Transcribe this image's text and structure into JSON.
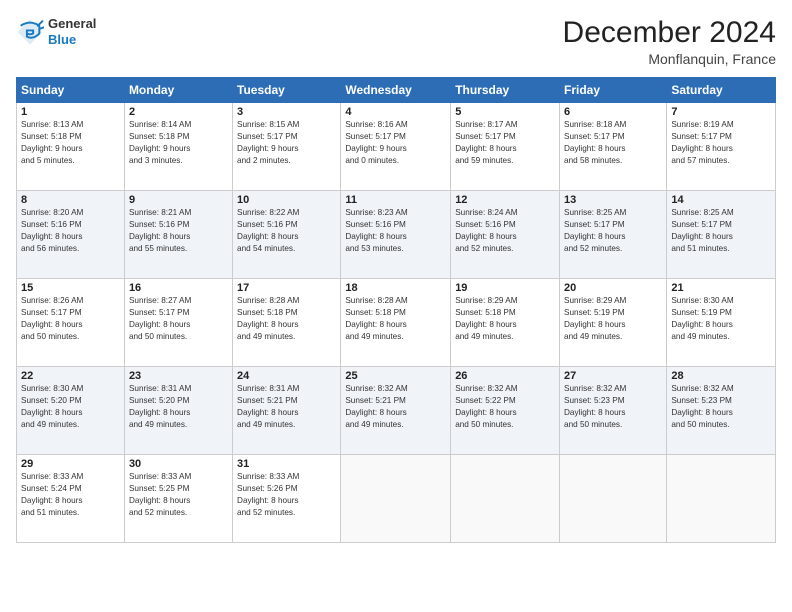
{
  "logo": {
    "general": "General",
    "blue": "Blue"
  },
  "header": {
    "title": "December 2024",
    "subtitle": "Monflanquin, France"
  },
  "calendar": {
    "headers": [
      "Sunday",
      "Monday",
      "Tuesday",
      "Wednesday",
      "Thursday",
      "Friday",
      "Saturday"
    ],
    "weeks": [
      [
        null,
        null,
        null,
        null,
        null,
        null,
        {
          "day": "7",
          "sunrise": "8:19 AM",
          "sunset": "5:17 PM",
          "daylight": "8 hours and 57 minutes."
        }
      ],
      [
        {
          "day": "1",
          "sunrise": "8:13 AM",
          "sunset": "5:18 PM",
          "daylight": "9 hours and 5 minutes."
        },
        {
          "day": "2",
          "sunrise": "8:14 AM",
          "sunset": "5:18 PM",
          "daylight": "9 hours and 3 minutes."
        },
        {
          "day": "3",
          "sunrise": "8:15 AM",
          "sunset": "5:17 PM",
          "daylight": "9 hours and 2 minutes."
        },
        {
          "day": "4",
          "sunrise": "8:16 AM",
          "sunset": "5:17 PM",
          "daylight": "9 hours and 0 minutes."
        },
        {
          "day": "5",
          "sunrise": "8:17 AM",
          "sunset": "5:17 PM",
          "daylight": "8 hours and 59 minutes."
        },
        {
          "day": "6",
          "sunrise": "8:18 AM",
          "sunset": "5:17 PM",
          "daylight": "8 hours and 58 minutes."
        },
        {
          "day": "7",
          "sunrise": "8:19 AM",
          "sunset": "5:17 PM",
          "daylight": "8 hours and 57 minutes."
        }
      ],
      [
        {
          "day": "8",
          "sunrise": "8:20 AM",
          "sunset": "5:16 PM",
          "daylight": "8 hours and 56 minutes."
        },
        {
          "day": "9",
          "sunrise": "8:21 AM",
          "sunset": "5:16 PM",
          "daylight": "8 hours and 55 minutes."
        },
        {
          "day": "10",
          "sunrise": "8:22 AM",
          "sunset": "5:16 PM",
          "daylight": "8 hours and 54 minutes."
        },
        {
          "day": "11",
          "sunrise": "8:23 AM",
          "sunset": "5:16 PM",
          "daylight": "8 hours and 53 minutes."
        },
        {
          "day": "12",
          "sunrise": "8:24 AM",
          "sunset": "5:16 PM",
          "daylight": "8 hours and 52 minutes."
        },
        {
          "day": "13",
          "sunrise": "8:25 AM",
          "sunset": "5:17 PM",
          "daylight": "8 hours and 52 minutes."
        },
        {
          "day": "14",
          "sunrise": "8:25 AM",
          "sunset": "5:17 PM",
          "daylight": "8 hours and 51 minutes."
        }
      ],
      [
        {
          "day": "15",
          "sunrise": "8:26 AM",
          "sunset": "5:17 PM",
          "daylight": "8 hours and 50 minutes."
        },
        {
          "day": "16",
          "sunrise": "8:27 AM",
          "sunset": "5:17 PM",
          "daylight": "8 hours and 50 minutes."
        },
        {
          "day": "17",
          "sunrise": "8:28 AM",
          "sunset": "5:18 PM",
          "daylight": "8 hours and 49 minutes."
        },
        {
          "day": "18",
          "sunrise": "8:28 AM",
          "sunset": "5:18 PM",
          "daylight": "8 hours and 49 minutes."
        },
        {
          "day": "19",
          "sunrise": "8:29 AM",
          "sunset": "5:18 PM",
          "daylight": "8 hours and 49 minutes."
        },
        {
          "day": "20",
          "sunrise": "8:29 AM",
          "sunset": "5:19 PM",
          "daylight": "8 hours and 49 minutes."
        },
        {
          "day": "21",
          "sunrise": "8:30 AM",
          "sunset": "5:19 PM",
          "daylight": "8 hours and 49 minutes."
        }
      ],
      [
        {
          "day": "22",
          "sunrise": "8:30 AM",
          "sunset": "5:20 PM",
          "daylight": "8 hours and 49 minutes."
        },
        {
          "day": "23",
          "sunrise": "8:31 AM",
          "sunset": "5:20 PM",
          "daylight": "8 hours and 49 minutes."
        },
        {
          "day": "24",
          "sunrise": "8:31 AM",
          "sunset": "5:21 PM",
          "daylight": "8 hours and 49 minutes."
        },
        {
          "day": "25",
          "sunrise": "8:32 AM",
          "sunset": "5:21 PM",
          "daylight": "8 hours and 49 minutes."
        },
        {
          "day": "26",
          "sunrise": "8:32 AM",
          "sunset": "5:22 PM",
          "daylight": "8 hours and 50 minutes."
        },
        {
          "day": "27",
          "sunrise": "8:32 AM",
          "sunset": "5:23 PM",
          "daylight": "8 hours and 50 minutes."
        },
        {
          "day": "28",
          "sunrise": "8:32 AM",
          "sunset": "5:23 PM",
          "daylight": "8 hours and 50 minutes."
        }
      ],
      [
        {
          "day": "29",
          "sunrise": "8:33 AM",
          "sunset": "5:24 PM",
          "daylight": "8 hours and 51 minutes."
        },
        {
          "day": "30",
          "sunrise": "8:33 AM",
          "sunset": "5:25 PM",
          "daylight": "8 hours and 52 minutes."
        },
        {
          "day": "31",
          "sunrise": "8:33 AM",
          "sunset": "5:26 PM",
          "daylight": "8 hours and 52 minutes."
        },
        null,
        null,
        null,
        null
      ]
    ]
  }
}
